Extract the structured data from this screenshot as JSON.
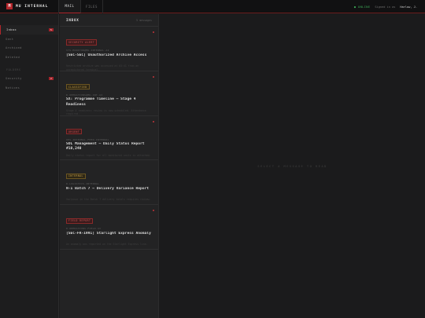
{
  "brand": {
    "mark": "M",
    "name": "MU INTERNAL"
  },
  "tabs": [
    {
      "label": "MAIL"
    },
    {
      "label": "FILES"
    }
  ],
  "status": {
    "online": "● ONLINE",
    "signed_in_label": "Signed in as",
    "user": "Harlow, J."
  },
  "sidebar": {
    "sections": [
      {
        "label": "",
        "items": [
          {
            "label": "Inbox",
            "badge": "5"
          },
          {
            "label": "Sent",
            "badge": ""
          },
          {
            "label": "Archived",
            "badge": ""
          },
          {
            "label": "Deleted",
            "badge": ""
          }
        ]
      },
      {
        "label": "FOLDERS",
        "items": [
          {
            "label": "Security",
            "badge": "2"
          },
          {
            "label": "Notices",
            "badge": ""
          }
        ]
      }
    ]
  },
  "list": {
    "title": "INBOX",
    "count": "5 messages",
    "messages": [
      {
        "tag": "SECURITY ALERT",
        "from": "SYS-MONITOR@MU-INTERNAL.AI",
        "subject": "[SEC-SEC] Unauthorized Archive Access",
        "preview": "Restricted archive was accessed at 03:41 from an unregistered terminal.",
        "unread": true
      },
      {
        "tag": "CLASSIFIED",
        "from": "R.OPERATIONS@MU-INT.AI",
        "subject": "SX: Programme Timeline — Stage 4 Readiness",
        "preview": "Stage 4 readiness review is now scheduled. Attendance required.",
        "unread": true
      },
      {
        "tag": "URGENT",
        "from": "OPS-INTERNAL.FEED.INTERNAL",
        "subject": "SOL Management — Daily Status Report #10,240",
        "preview": "Daily status report for all monitored units is attached.",
        "unread": true
      },
      {
        "tag": "INTERNAL",
        "from": "R.LOGISTICS-INTERNAL",
        "subject": "N-1 Batch 7 — Delivery Variance Report",
        "preview": "Variance in the Batch 7 delivery totals requires review.",
        "unread": false
      },
      {
        "tag": "FIELD REPORT",
        "from": "R.OPERATIONS.FIELD.AI",
        "subject": "[SEC-FR-1991] Starlight Express Anomaly",
        "preview": "An anomaly was reported on the Starlight Express line.",
        "unread": true
      }
    ]
  },
  "reader": {
    "empty_text": "SELECT A MESSAGE TO READ"
  },
  "colors": {
    "accent": "#b3262b",
    "online": "#3faf5a",
    "tag_red": "#d05a5a",
    "tag_amber": "#c9a24a"
  }
}
